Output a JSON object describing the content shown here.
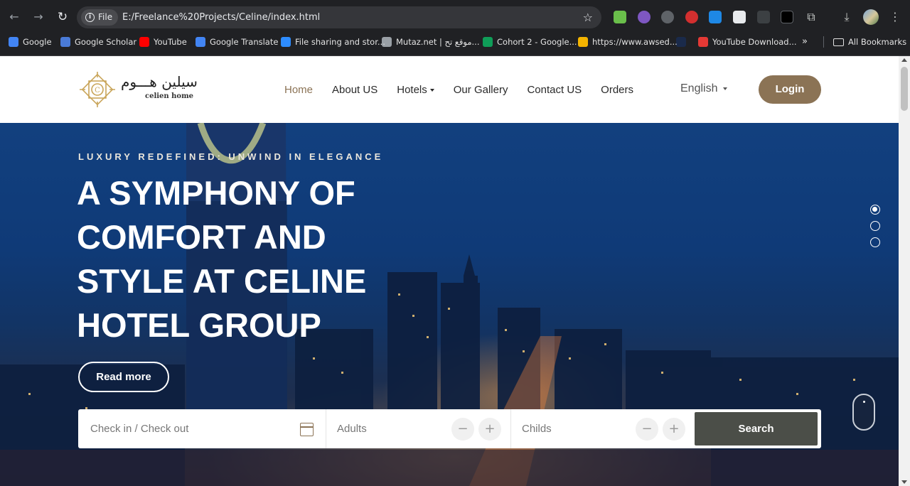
{
  "browser": {
    "site_chip": "File",
    "url": "E:/Freelance%20Projects/Celine/index.html",
    "bookmarks": [
      {
        "label": "Google",
        "color": "#4285f4"
      },
      {
        "label": "Google Scholar",
        "color": "#4a7bd8"
      },
      {
        "label": "YouTube",
        "color": "#ff0000"
      },
      {
        "label": "Google Translate",
        "color": "#4285f4"
      },
      {
        "label": "File sharing and stor...",
        "color": "#2d8cff"
      },
      {
        "label": "Mutaz.net | موقع تح...",
        "color": "#9aa0a6"
      },
      {
        "label": "Cohort 2 - Google...",
        "color": "#0f9d58"
      },
      {
        "label": "https://www.awsed...",
        "color": "#f4b400"
      },
      {
        "label": "",
        "color": "#1a2a4a"
      },
      {
        "label": "YouTube Download...",
        "color": "#e53935"
      }
    ],
    "more_label": "»",
    "all_bookmarks": "All Bookmarks"
  },
  "site": {
    "logo_ar": "سيلين هـــوم",
    "logo_en": "celien home",
    "menu": [
      {
        "label": "Home",
        "active": true
      },
      {
        "label": "About US"
      },
      {
        "label": "Hotels",
        "dropdown": true
      },
      {
        "label": "Our Gallery"
      },
      {
        "label": "Contact US"
      },
      {
        "label": "Orders"
      }
    ],
    "language": "English",
    "login_label": "Login",
    "accent": "#8b7355"
  },
  "hero": {
    "eyebrow": "LUXURY REDEFINED: UNWIND IN ELEGANCE",
    "headline": "A SYMPHONY OF COMFORT AND STYLE AT CELINE HOTEL GROUP",
    "read_more": "Read more"
  },
  "booking": {
    "dates_placeholder": "Check in / Check out",
    "adults_label": "Adults",
    "childs_label": "Childs",
    "minus": "−",
    "plus": "+",
    "search_label": "Search"
  }
}
